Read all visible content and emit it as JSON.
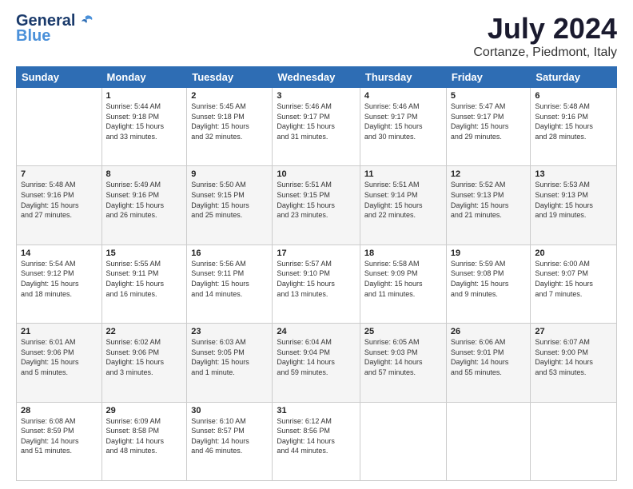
{
  "header": {
    "logo_line1": "General",
    "logo_line2": "Blue",
    "month_year": "July 2024",
    "location": "Cortanze, Piedmont, Italy"
  },
  "days_of_week": [
    "Sunday",
    "Monday",
    "Tuesday",
    "Wednesday",
    "Thursday",
    "Friday",
    "Saturday"
  ],
  "weeks": [
    [
      {
        "day": "",
        "info": ""
      },
      {
        "day": "1",
        "info": "Sunrise: 5:44 AM\nSunset: 9:18 PM\nDaylight: 15 hours\nand 33 minutes."
      },
      {
        "day": "2",
        "info": "Sunrise: 5:45 AM\nSunset: 9:18 PM\nDaylight: 15 hours\nand 32 minutes."
      },
      {
        "day": "3",
        "info": "Sunrise: 5:46 AM\nSunset: 9:17 PM\nDaylight: 15 hours\nand 31 minutes."
      },
      {
        "day": "4",
        "info": "Sunrise: 5:46 AM\nSunset: 9:17 PM\nDaylight: 15 hours\nand 30 minutes."
      },
      {
        "day": "5",
        "info": "Sunrise: 5:47 AM\nSunset: 9:17 PM\nDaylight: 15 hours\nand 29 minutes."
      },
      {
        "day": "6",
        "info": "Sunrise: 5:48 AM\nSunset: 9:16 PM\nDaylight: 15 hours\nand 28 minutes."
      }
    ],
    [
      {
        "day": "7",
        "info": "Sunrise: 5:48 AM\nSunset: 9:16 PM\nDaylight: 15 hours\nand 27 minutes."
      },
      {
        "day": "8",
        "info": "Sunrise: 5:49 AM\nSunset: 9:16 PM\nDaylight: 15 hours\nand 26 minutes."
      },
      {
        "day": "9",
        "info": "Sunrise: 5:50 AM\nSunset: 9:15 PM\nDaylight: 15 hours\nand 25 minutes."
      },
      {
        "day": "10",
        "info": "Sunrise: 5:51 AM\nSunset: 9:15 PM\nDaylight: 15 hours\nand 23 minutes."
      },
      {
        "day": "11",
        "info": "Sunrise: 5:51 AM\nSunset: 9:14 PM\nDaylight: 15 hours\nand 22 minutes."
      },
      {
        "day": "12",
        "info": "Sunrise: 5:52 AM\nSunset: 9:13 PM\nDaylight: 15 hours\nand 21 minutes."
      },
      {
        "day": "13",
        "info": "Sunrise: 5:53 AM\nSunset: 9:13 PM\nDaylight: 15 hours\nand 19 minutes."
      }
    ],
    [
      {
        "day": "14",
        "info": "Sunrise: 5:54 AM\nSunset: 9:12 PM\nDaylight: 15 hours\nand 18 minutes."
      },
      {
        "day": "15",
        "info": "Sunrise: 5:55 AM\nSunset: 9:11 PM\nDaylight: 15 hours\nand 16 minutes."
      },
      {
        "day": "16",
        "info": "Sunrise: 5:56 AM\nSunset: 9:11 PM\nDaylight: 15 hours\nand 14 minutes."
      },
      {
        "day": "17",
        "info": "Sunrise: 5:57 AM\nSunset: 9:10 PM\nDaylight: 15 hours\nand 13 minutes."
      },
      {
        "day": "18",
        "info": "Sunrise: 5:58 AM\nSunset: 9:09 PM\nDaylight: 15 hours\nand 11 minutes."
      },
      {
        "day": "19",
        "info": "Sunrise: 5:59 AM\nSunset: 9:08 PM\nDaylight: 15 hours\nand 9 minutes."
      },
      {
        "day": "20",
        "info": "Sunrise: 6:00 AM\nSunset: 9:07 PM\nDaylight: 15 hours\nand 7 minutes."
      }
    ],
    [
      {
        "day": "21",
        "info": "Sunrise: 6:01 AM\nSunset: 9:06 PM\nDaylight: 15 hours\nand 5 minutes."
      },
      {
        "day": "22",
        "info": "Sunrise: 6:02 AM\nSunset: 9:06 PM\nDaylight: 15 hours\nand 3 minutes."
      },
      {
        "day": "23",
        "info": "Sunrise: 6:03 AM\nSunset: 9:05 PM\nDaylight: 15 hours\nand 1 minute."
      },
      {
        "day": "24",
        "info": "Sunrise: 6:04 AM\nSunset: 9:04 PM\nDaylight: 14 hours\nand 59 minutes."
      },
      {
        "day": "25",
        "info": "Sunrise: 6:05 AM\nSunset: 9:03 PM\nDaylight: 14 hours\nand 57 minutes."
      },
      {
        "day": "26",
        "info": "Sunrise: 6:06 AM\nSunset: 9:01 PM\nDaylight: 14 hours\nand 55 minutes."
      },
      {
        "day": "27",
        "info": "Sunrise: 6:07 AM\nSunset: 9:00 PM\nDaylight: 14 hours\nand 53 minutes."
      }
    ],
    [
      {
        "day": "28",
        "info": "Sunrise: 6:08 AM\nSunset: 8:59 PM\nDaylight: 14 hours\nand 51 minutes."
      },
      {
        "day": "29",
        "info": "Sunrise: 6:09 AM\nSunset: 8:58 PM\nDaylight: 14 hours\nand 48 minutes."
      },
      {
        "day": "30",
        "info": "Sunrise: 6:10 AM\nSunset: 8:57 PM\nDaylight: 14 hours\nand 46 minutes."
      },
      {
        "day": "31",
        "info": "Sunrise: 6:12 AM\nSunset: 8:56 PM\nDaylight: 14 hours\nand 44 minutes."
      },
      {
        "day": "",
        "info": ""
      },
      {
        "day": "",
        "info": ""
      },
      {
        "day": "",
        "info": ""
      }
    ]
  ]
}
